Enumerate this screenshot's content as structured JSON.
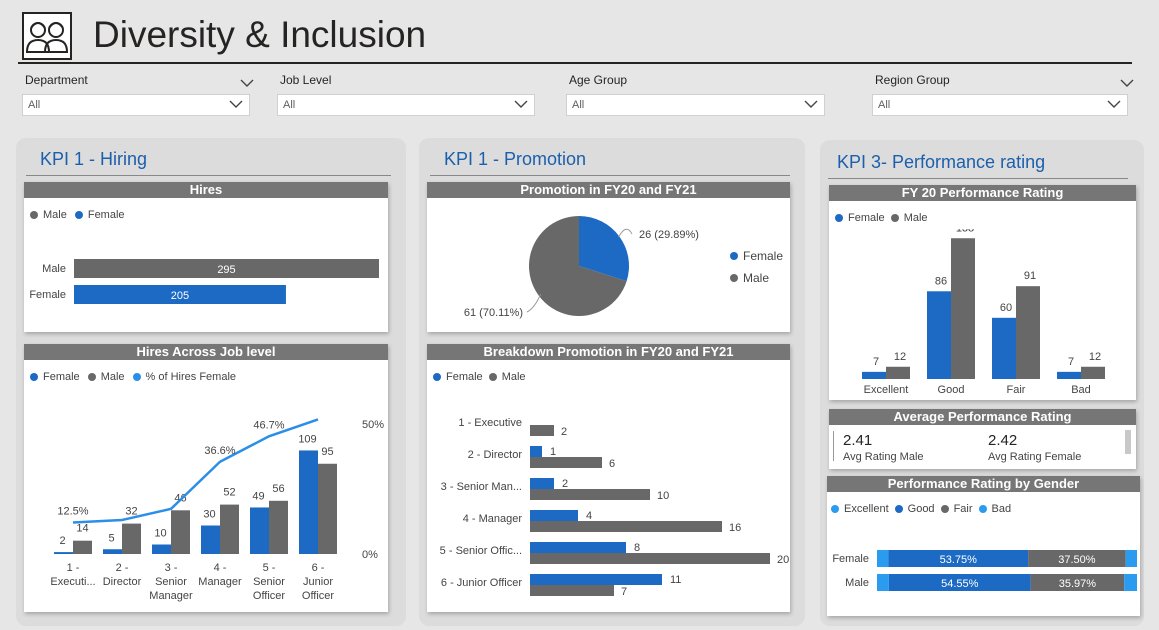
{
  "header": {
    "title": "Diversity & Inclusion",
    "icon": "people-icon"
  },
  "colors": {
    "female": "#1c6ac4",
    "male": "#686868",
    "pct": "#2b8ee8",
    "title_blue": "#1b5fad",
    "fair": "#686868",
    "bad": "#2b9bf0"
  },
  "filters": [
    {
      "label": "Department",
      "value": "All"
    },
    {
      "label": "Job Level",
      "value": "All"
    },
    {
      "label": "Age Group",
      "value": "All"
    },
    {
      "label": "Region Group",
      "value": "All"
    }
  ],
  "kpi1": {
    "title": "KPI 1 - Hiring",
    "hires": {
      "title": "Hires",
      "legend": [
        "Male",
        "Female"
      ],
      "chart_data": {
        "type": "bar",
        "categories": [
          "Male",
          "Female"
        ],
        "values": [
          295,
          205
        ]
      }
    },
    "hires_job": {
      "title": "Hires Across Job level",
      "legend": [
        "Female",
        "Male",
        "% of Hires Female"
      ],
      "y2_ticks": [
        "50%",
        "0%"
      ],
      "chart_data": {
        "type": "bar",
        "categories": [
          [
            "1 -",
            "Executi..."
          ],
          [
            "2 -",
            "Director"
          ],
          [
            "3 -",
            "Senior",
            "Manager"
          ],
          [
            "4 -",
            "Manager"
          ],
          [
            "5 -",
            "Senior",
            "Officer"
          ],
          [
            "6 -",
            "Junior",
            "Officer"
          ]
        ],
        "series": [
          {
            "name": "Female",
            "values": [
              2,
              5,
              10,
              30,
              49,
              109
            ]
          },
          {
            "name": "Male",
            "values": [
              14,
              32,
              46,
              52,
              56,
              95
            ]
          },
          {
            "name": "% of Hires Female",
            "values": [
              12.5,
              13.5,
              17.9,
              36.6,
              46.7,
              53.4
            ],
            "labels": [
              "12.5%",
              "",
              "",
              "36.6%",
              "46.7%",
              ""
            ]
          }
        ],
        "ylim": [
          0,
          115
        ],
        "y2lim": [
          0,
          50
        ]
      }
    }
  },
  "kpi_promo": {
    "title": "KPI 1 - Promotion",
    "promo": {
      "title": "Promotion in FY20 and FY21",
      "legend": [
        "Female",
        "Male"
      ],
      "chart_data": {
        "type": "pie",
        "labels": [
          "Female",
          "Male"
        ],
        "values": [
          26,
          61
        ],
        "data_labels": [
          "26 (29.89%)",
          "61 (70.11%)"
        ]
      }
    },
    "breakdown": {
      "title": "Breakdown Promotion in FY20 and FY21",
      "legend": [
        "Female",
        "Male"
      ],
      "chart_data": {
        "type": "bar",
        "categories": [
          "1 - Executive",
          "2 - Director",
          "3 - Senior Man...",
          "4 - Manager",
          "5 - Senior Offic...",
          "6 - Junior Officer"
        ],
        "series": [
          {
            "name": "Female",
            "values": [
              0,
              1,
              2,
              4,
              8,
              11
            ]
          },
          {
            "name": "Male",
            "values": [
              2,
              6,
              10,
              16,
              20,
              7
            ]
          }
        ],
        "xlim": [
          0,
          20
        ]
      }
    }
  },
  "kpi3": {
    "title": "KPI 3- Performance rating",
    "fy20": {
      "title": "FY 20 Performance Rating",
      "legend": [
        "Female",
        "Male"
      ],
      "chart_data": {
        "type": "bar",
        "categories": [
          "Excellent",
          "Good",
          "Fair",
          "Bad"
        ],
        "series": [
          {
            "name": "Female",
            "values": [
              7,
              86,
              60,
              7
            ]
          },
          {
            "name": "Male",
            "values": [
              12,
              138,
              91,
              12
            ]
          }
        ],
        "ylim": [
          0,
          140
        ]
      }
    },
    "avg": {
      "title": "Average Performance Rating",
      "male_value": "2.41",
      "male_label": "Avg Rating Male",
      "female_value": "2.42",
      "female_label": "Avg Rating Female"
    },
    "by_gender": {
      "title": "Performance Rating by Gender",
      "legend": [
        "Excellent",
        "Good",
        "Fair",
        "Bad"
      ],
      "chart_data": {
        "type": "bar",
        "stacked": true,
        "categories": [
          "Female",
          "Male"
        ],
        "series": [
          {
            "name": "Excellent",
            "values": [
              4.38,
              4.55
            ]
          },
          {
            "name": "Good",
            "values": [
              53.75,
              54.55
            ]
          },
          {
            "name": "Fair",
            "values": [
              37.5,
              35.97
            ]
          },
          {
            "name": "Bad",
            "values": [
              4.38,
              4.93
            ]
          }
        ],
        "data_labels": [
          [
            "53.75%",
            "37.50%"
          ],
          [
            "54.55%",
            "35.97%"
          ]
        ]
      }
    }
  }
}
